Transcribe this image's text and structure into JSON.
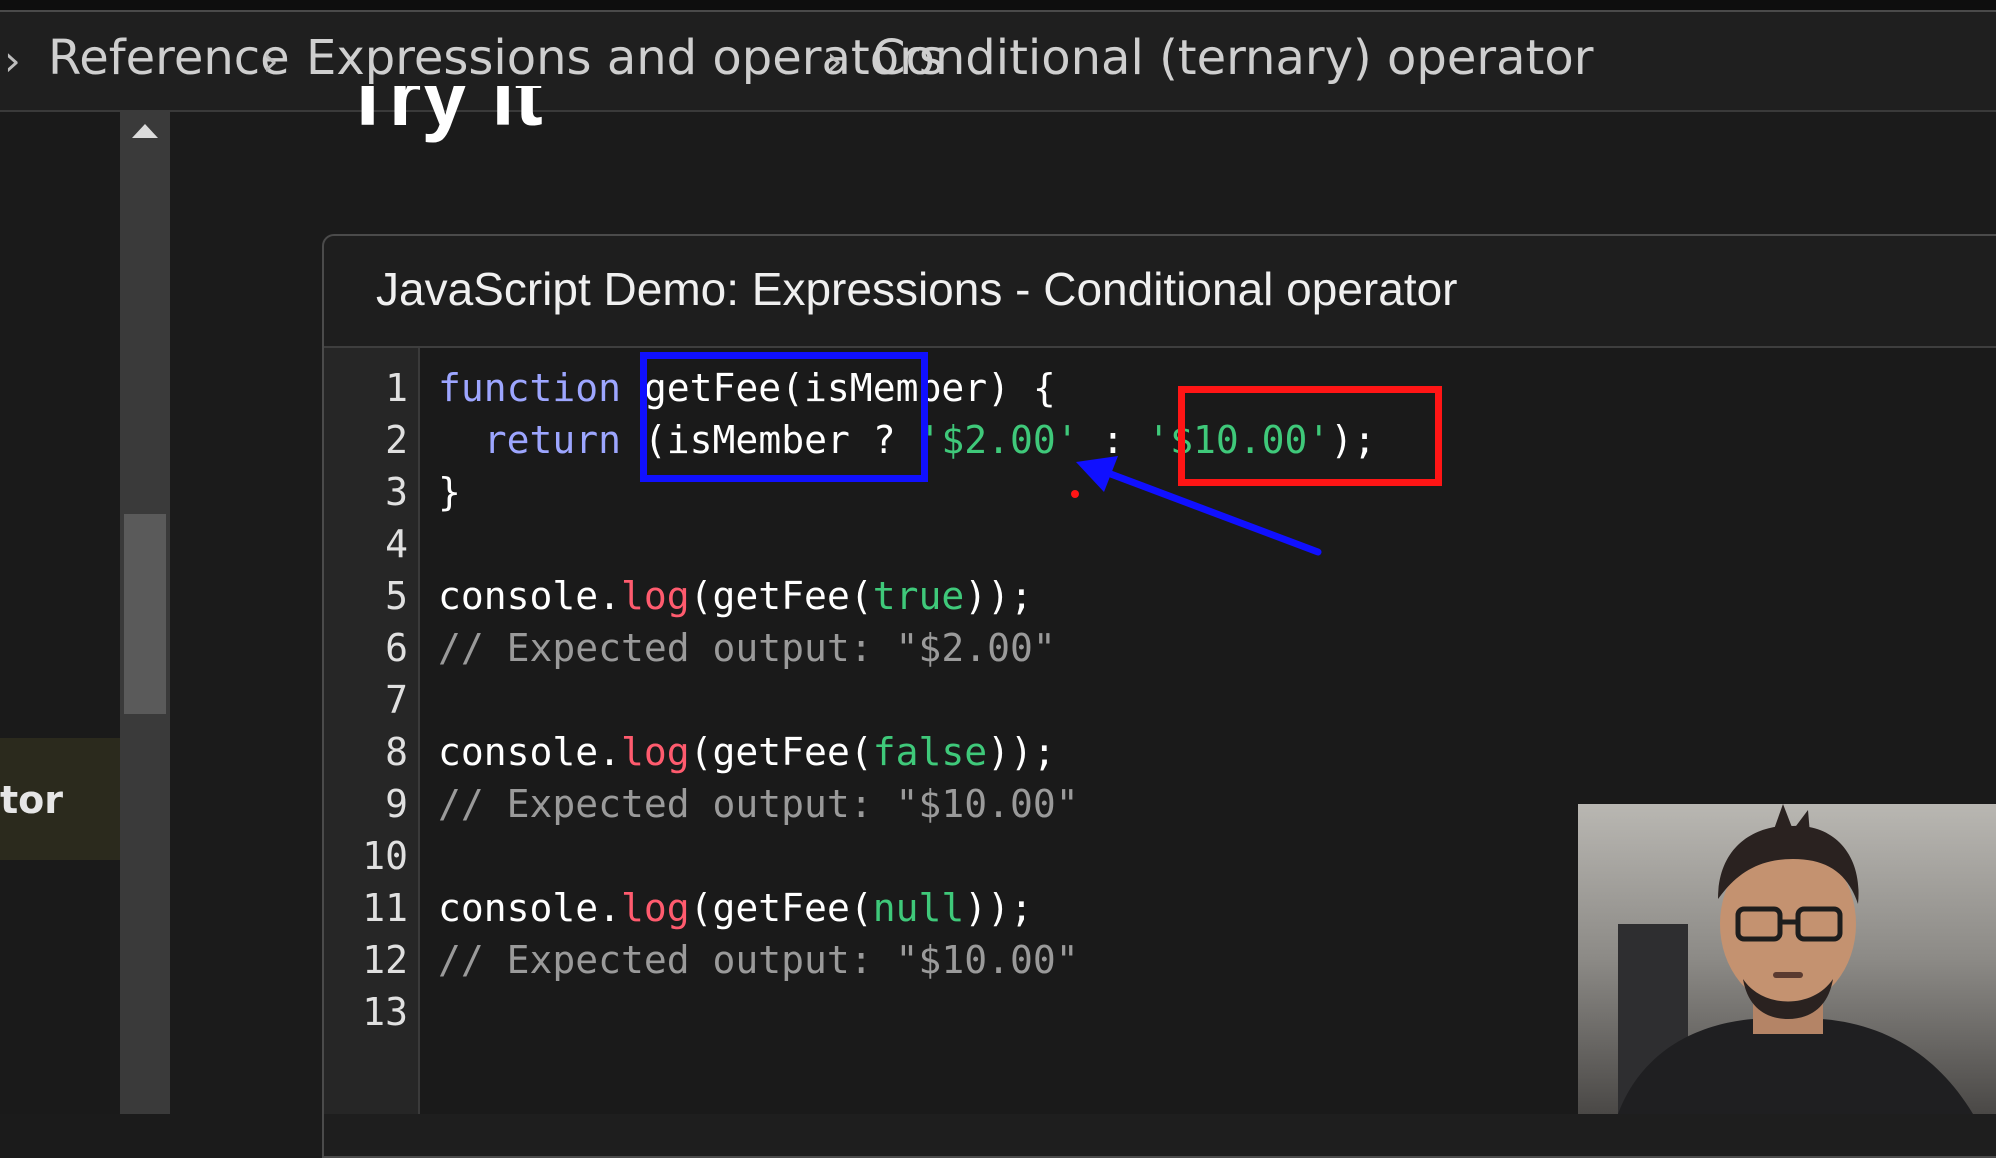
{
  "breadcrumb": {
    "items": [
      "Reference",
      "Expressions and operators",
      "Conditional (ternary) operator"
    ]
  },
  "sidebar": {
    "active_item_partial": "tor"
  },
  "page": {
    "heading_partial": "Try it"
  },
  "demo": {
    "title": "JavaScript Demo: Expressions - Conditional operator",
    "line_numbers": [
      "1",
      "2",
      "3",
      "4",
      "5",
      "6",
      "7",
      "8",
      "9",
      "10",
      "11",
      "12",
      "13"
    ],
    "code": {
      "l1_kw": "function",
      "l1_rest": " getFee(isMember) {",
      "l2_kw": "return",
      "l2_a": " (isMember ? ",
      "l2_s1": "'$2.00'",
      "l2_b": " : ",
      "l2_s2": "'$10.00'",
      "l2_c": ");",
      "l3": "}",
      "l5_a": "console.",
      "l5_fn": "log",
      "l5_b": "(getFee(",
      "l5_arg": "true",
      "l5_c": "));",
      "l6": "// Expected output: \"$2.00\"",
      "l8_a": "console.",
      "l8_fn": "log",
      "l8_b": "(getFee(",
      "l8_arg": "false",
      "l8_c": "));",
      "l9": "// Expected output: \"$10.00\"",
      "l11_a": "console.",
      "l11_fn": "log",
      "l11_b": "(getFee(",
      "l11_arg": "null",
      "l11_c": "));",
      "l12": "// Expected output: \"$10.00\""
    }
  },
  "annotations": {
    "blue_color": "#1010ff",
    "red_color": "#ff1515"
  },
  "colors": {
    "keyword": "#9da6ff",
    "string": "#3fc97a",
    "function": "#ff5b6e",
    "comment": "#9a9a9a"
  }
}
